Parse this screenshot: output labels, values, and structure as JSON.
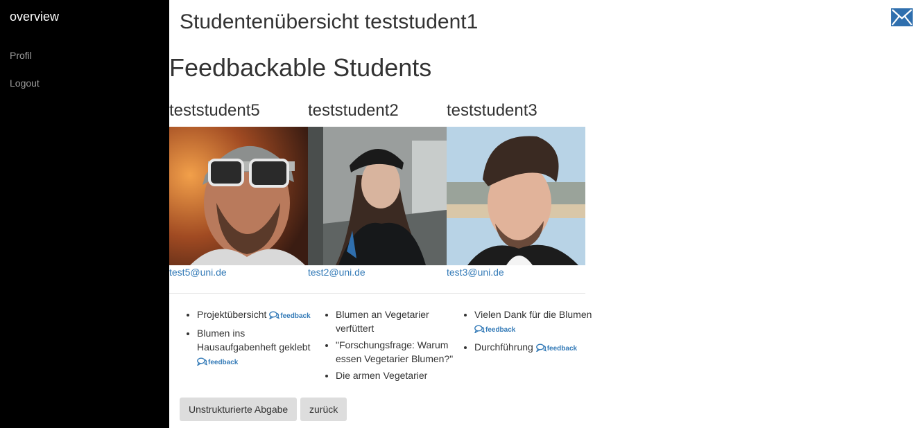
{
  "sidebar": {
    "brand": "overview",
    "items": [
      {
        "label": "Profil"
      },
      {
        "label": "Logout"
      }
    ]
  },
  "header": {
    "title": "Studentenübersicht teststudent1",
    "mail_icon": "envelope-icon"
  },
  "section_title": "Feedbackable Students",
  "students": [
    {
      "name": "teststudent5",
      "email": "test5@uni.de"
    },
    {
      "name": "teststudent2",
      "email": "test2@uni.de"
    },
    {
      "name": "teststudent3",
      "email": "test3@uni.de"
    }
  ],
  "feedback_lists": [
    {
      "items": [
        {
          "text": "Projektübersicht",
          "link": "feedback"
        },
        {
          "text": "Blumen ins Hausaufgabenheft geklebt",
          "link": "feedback"
        }
      ]
    },
    {
      "items": [
        {
          "text": "Blumen an Vegetarier verfüttert"
        },
        {
          "text": "\"Forschungsfrage: Warum essen Vegetarier Blumen?\""
        },
        {
          "text": "Die armen Vegetarier"
        }
      ]
    },
    {
      "items": [
        {
          "text": "Vielen Dank für die Blumen",
          "link": "feedback"
        },
        {
          "text": "Durchführung",
          "link": "feedback"
        }
      ]
    }
  ],
  "buttons": {
    "unstructured": "Unstrukturierte Abgabe",
    "back": "zurück"
  },
  "colors": {
    "sidebar_bg": "#000000",
    "link": "#337ab7",
    "button_bg": "#dddddd",
    "mail_icon": "#2f6fae"
  }
}
